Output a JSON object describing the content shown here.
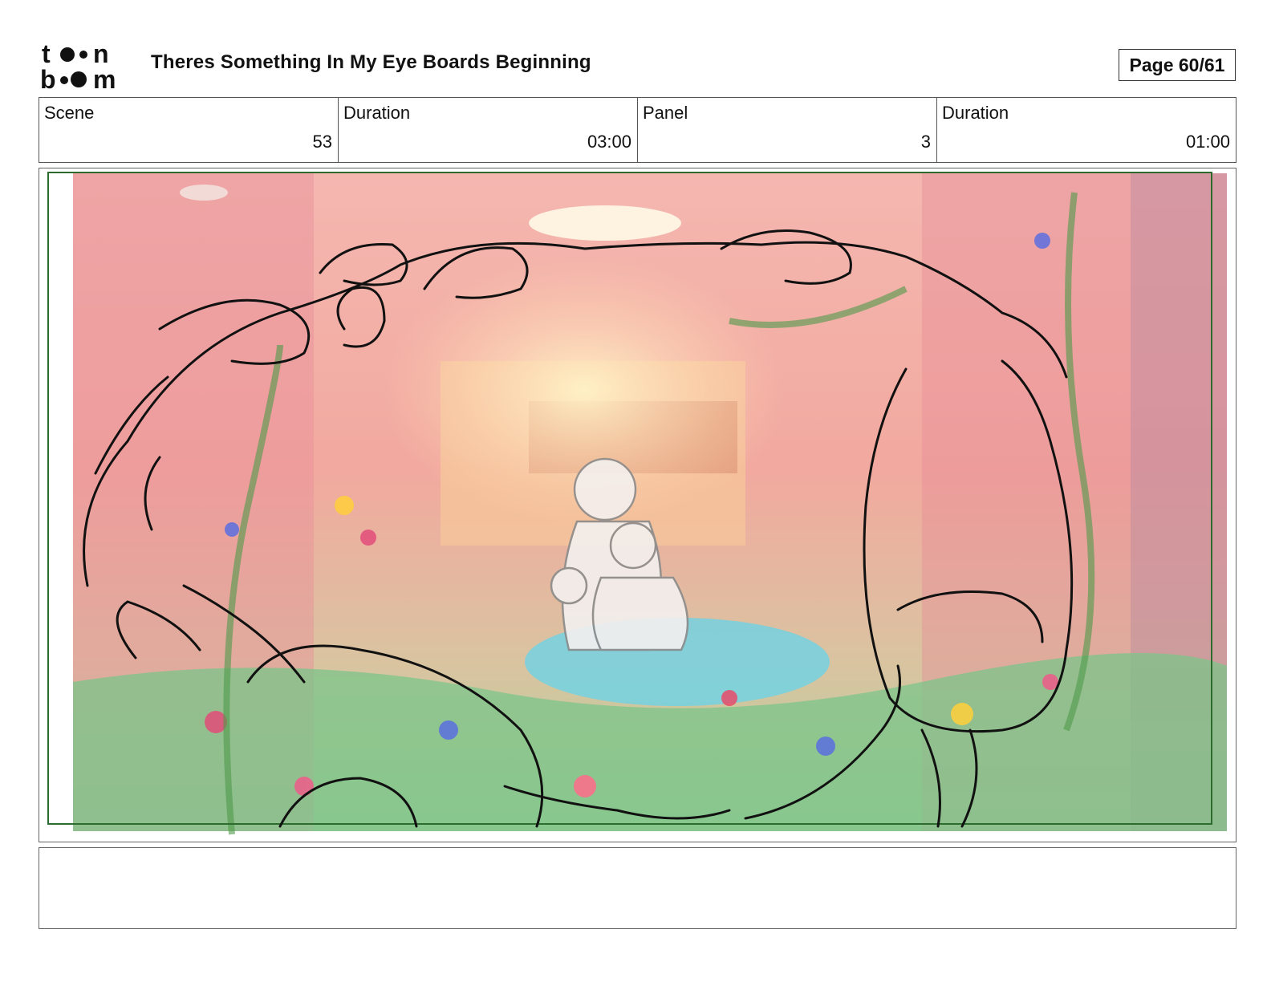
{
  "header": {
    "logo_text_top": "toon",
    "logo_text_bottom": "boom",
    "title": "Theres Something In My Eye Boards Beginning",
    "page": "Page 60/61"
  },
  "info": {
    "scene_label": "Scene",
    "scene_value": "53",
    "scene_duration_label": "Duration",
    "scene_duration_value": "03:00",
    "panel_label": "Panel",
    "panel_value": "3",
    "panel_duration_label": "Duration",
    "panel_duration_value": "01:00"
  },
  "panel": {
    "safe_frame_color": "#2e6b2e",
    "background_tint": "#f1a3a8"
  },
  "notes": {
    "text": ""
  }
}
